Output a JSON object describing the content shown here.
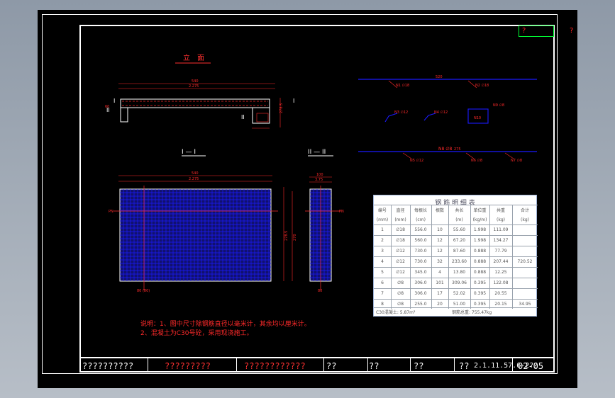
{
  "stamp": {
    "label": "?"
  },
  "side_mark": "?",
  "views": {
    "elevation_title": "立　面",
    "section_1_title": "I — I",
    "section_2_title": "II — II",
    "section_mark_1": "I",
    "section_mark_2": "II"
  },
  "dims": {
    "top_len": "540",
    "top_sub": "2.275",
    "left_dim": "60",
    "height": "278.5",
    "grid_len": "540",
    "grid_sub": "2.275",
    "sec_w": "100",
    "sec_sub": "3.75",
    "right_h1": "278.5",
    "right_h2": "270",
    "left_mark": "PN",
    "right_mark": "PN",
    "bot_left": "80 (80)",
    "bot_right": "80",
    "rebar_top": "520",
    "rebar_mid": "275",
    "r1": "N1 ∅18",
    "r2": "N2 ∅18",
    "r3": "N3 ∅12",
    "r4": "N4 ∅12",
    "r5": "N5 ∅12",
    "r6": "N6 ∅8",
    "r7": "N7 ∅8",
    "r8": "N8 ∅8",
    "r9": "N9 ∅8",
    "box": "N10"
  },
  "table": {
    "title": "钢 筋 明 细 表",
    "headers": [
      "编号",
      "直径",
      "每根长",
      "根数",
      "共长",
      "单位重",
      "共重",
      "合计"
    ],
    "units": [
      "(mm)",
      "(mm)",
      "(cm)",
      "",
      "(m)",
      "(kg/m)",
      "(kg)",
      "(kg)"
    ],
    "rows": [
      [
        "1",
        "∅18",
        "556.0",
        "10",
        "55.60",
        "1.998",
        "111.09",
        ""
      ],
      [
        "2",
        "∅18",
        "560.0",
        "12",
        "67.20",
        "1.998",
        "134.27",
        ""
      ],
      [
        "3",
        "∅12",
        "730.0",
        "12",
        "87.60",
        "0.888",
        "77.79",
        ""
      ],
      [
        "4",
        "∅12",
        "730.0",
        "32",
        "233.60",
        "0.888",
        "207.44",
        "720.52"
      ],
      [
        "5",
        "∅12",
        "345.0",
        "4",
        "13.80",
        "0.888",
        "12.25",
        ""
      ],
      [
        "6",
        "∅8",
        "306.0",
        "101",
        "309.06",
        "0.395",
        "122.08",
        ""
      ],
      [
        "7",
        "∅8",
        "306.0",
        "17",
        "52.02",
        "0.395",
        "20.55",
        ""
      ],
      [
        "8",
        "∅8",
        "255.0",
        "20",
        "51.00",
        "0.395",
        "20.15",
        "34.95"
      ]
    ],
    "footer_1": "C30混凝土: 5.87m³",
    "footer_2": "钢筋总重: 755.47kg"
  },
  "notes": "说明：1、图中尺寸除钢筋直径以毫米计，其余均以厘米计。2、混凝土为C30号砼，采用现浇施工。",
  "title_block": {
    "company": "??????????",
    "project": "?????????",
    "drawing_name": "????????????",
    "design": "??",
    "check": "??",
    "review": "??",
    "approve": "??",
    "drawing_no": "2.1.11.57.6-2??",
    "sheet": "02-05"
  },
  "colors": {
    "background": "#000000",
    "frame": "#ffffff",
    "dim_red": "#ff2a2a",
    "grid_blue": "#1a1aff",
    "mesh_fill": "#11116e",
    "cyan": "#00c8ff",
    "title_red": "#ff3030"
  }
}
